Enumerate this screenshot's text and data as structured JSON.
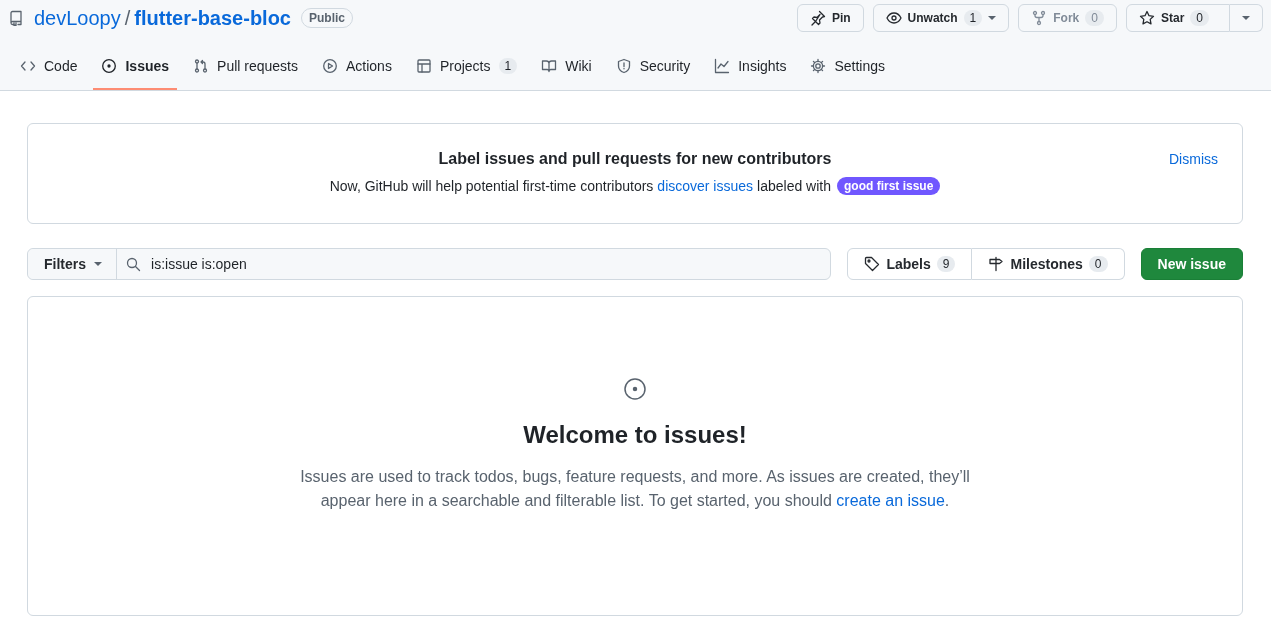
{
  "repo": {
    "owner": "devLoopy",
    "separator": "/",
    "name": "flutter-base-bloc",
    "visibility": "Public"
  },
  "repo_actions": [
    {
      "kind": "pin",
      "label": "Pin",
      "disabled": false
    },
    {
      "kind": "watch",
      "label": "Unwatch",
      "count": "1",
      "dropdown": true,
      "disabled": false
    },
    {
      "kind": "fork",
      "label": "Fork",
      "count": "0",
      "disabled": true
    },
    {
      "kind": "star",
      "label": "Star",
      "count": "0",
      "dropdown": true,
      "disabled": false
    }
  ],
  "tabs": [
    {
      "label": "Code",
      "selected": false
    },
    {
      "label": "Issues",
      "selected": true
    },
    {
      "label": "Pull requests",
      "selected": false
    },
    {
      "label": "Actions",
      "selected": false
    },
    {
      "label": "Projects",
      "count": "1",
      "selected": false
    },
    {
      "label": "Wiki",
      "selected": false
    },
    {
      "label": "Security",
      "selected": false
    },
    {
      "label": "Insights",
      "selected": false
    },
    {
      "label": "Settings",
      "selected": false
    }
  ],
  "banner": {
    "title": "Label issues and pull requests for new contributors",
    "text_before": "Now, GitHub will help potential first-time contributors",
    "link": "discover issues",
    "text_after": "labeled with",
    "label": "good first issue",
    "dismiss": "Dismiss"
  },
  "toolbar": {
    "filters": "Filters",
    "search_value": "is:issue is:open",
    "labels": {
      "label": "Labels",
      "count": "9"
    },
    "milestones": {
      "label": "Milestones",
      "count": "0"
    },
    "new_issue": "New issue"
  },
  "blankslate": {
    "title": "Welcome to issues!",
    "text": "Issues are used to track todos, bugs, feature requests, and more. As issues are created, they’ll appear here in a searchable and filterable list. To get started, you should",
    "link": "create an issue",
    "end": "."
  }
}
